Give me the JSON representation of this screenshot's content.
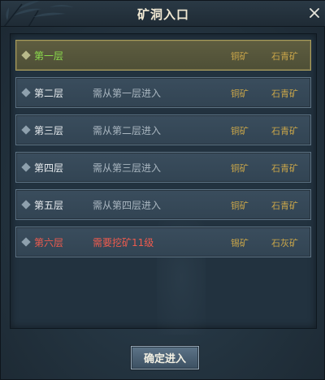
{
  "window": {
    "title": "矿洞入口"
  },
  "floors": [
    {
      "name": "第一层",
      "requirement": "",
      "ore1": "铜矿",
      "ore2": "石青矿",
      "state": "selected"
    },
    {
      "name": "第二层",
      "requirement": "需从第一层进入",
      "ore1": "铜矿",
      "ore2": "石青矿",
      "state": "normal"
    },
    {
      "name": "第三层",
      "requirement": "需从第二层进入",
      "ore1": "铜矿",
      "ore2": "石青矿",
      "state": "normal"
    },
    {
      "name": "第四层",
      "requirement": "需从第三层进入",
      "ore1": "铜矿",
      "ore2": "石青矿",
      "state": "normal"
    },
    {
      "name": "第五层",
      "requirement": "需从第四层进入",
      "ore1": "铜矿",
      "ore2": "石青矿",
      "state": "normal"
    },
    {
      "name": "第六层",
      "requirement": "需要挖矿11级",
      "ore1": "锡矿",
      "ore2": "石灰矿",
      "state": "locked"
    }
  ],
  "buttons": {
    "confirm": "确定进入"
  },
  "icons": {
    "close": "close-icon",
    "bullet": "diamond-icon"
  },
  "colors": {
    "selected_name": "#8bdc4c",
    "locked_text": "#ef5b4e",
    "ore_text": "#c9a549"
  }
}
